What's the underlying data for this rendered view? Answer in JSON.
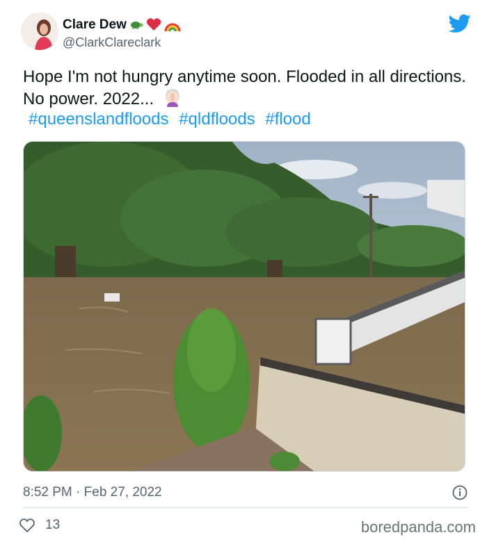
{
  "user": {
    "display_name": "Clare Dew",
    "handle": "@ClarkClareclark",
    "name_emojis": [
      "turtle-emoji",
      "red-heart-emoji",
      "rainbow-emoji"
    ]
  },
  "tweet": {
    "text": "Hope I'm not hungry anytime soon. Flooded in all directions. No power. 2022...",
    "text_emoji": "woman-facepalming-emoji",
    "hashtags": [
      "#queenslandfloods",
      "#qldfloods",
      "#flood"
    ],
    "timestamp": "8:52 PM · Feb 27, 2022",
    "like_count": "13"
  },
  "footer": {
    "watermark": "boredpanda.com"
  },
  "colors": {
    "link": "#1d9bf0",
    "secondary_text": "#536471",
    "twitter_blue": "#1d9bf0"
  }
}
